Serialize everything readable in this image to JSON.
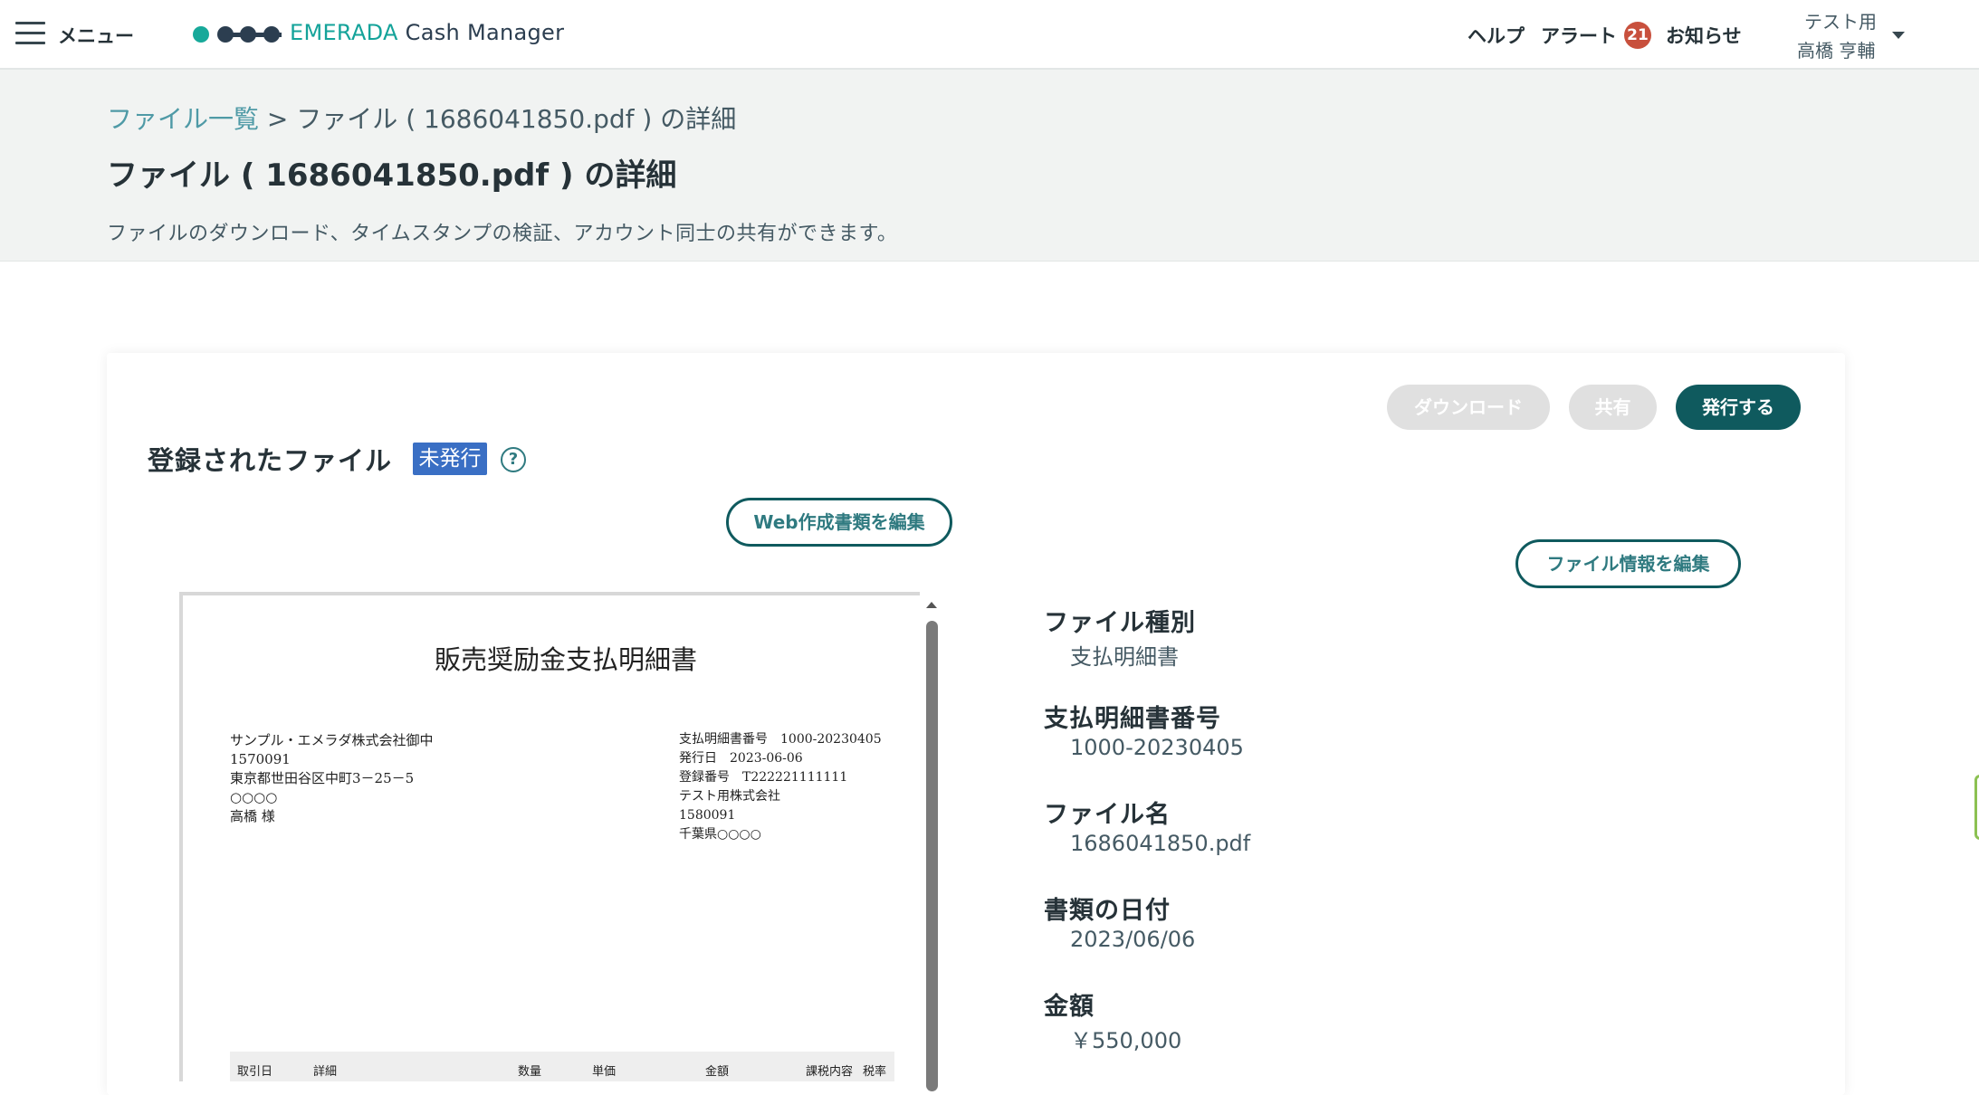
{
  "header": {
    "menu_label": "メニュー",
    "brand_part1": "EMERADA",
    "brand_part2": "Cash Manager",
    "help_label": "ヘルプ",
    "alert_label": "アラート",
    "alert_count": "21",
    "notice_label": "お知らせ",
    "user_org": "テスト用",
    "user_name": "高橋 亨輔"
  },
  "breadcrumb": {
    "link_label": "ファイル一覧",
    "separator": ">",
    "current": "ファイル ( 1686041850.pdf ) の詳細"
  },
  "page": {
    "title": "ファイル ( 1686041850.pdf ) の詳細",
    "description": "ファイルのダウンロード、タイムスタンプの検証、アカウント同士の共有ができます。"
  },
  "actions": {
    "download_label": "ダウンロード",
    "share_label": "共有",
    "issue_label": "発行する",
    "edit_web_doc_label": "Web作成書類を編集",
    "edit_file_info_label": "ファイル情報を編集"
  },
  "registered": {
    "section_title": "登録されたファイル",
    "status": "未発行",
    "help_symbol": "?"
  },
  "document": {
    "title": "販売奨励金支払明細書",
    "recipient_lines": [
      "サンプル・エメラダ株式会社御中",
      "1570091",
      "東京都世田谷区中町3－25－5",
      "○○○○",
      "高橋 様"
    ],
    "issuer_lines": [
      "支払明細書番号　1000-20230405",
      "発行日　2023-06-06",
      "登録番号　T222221111111",
      "テスト用株式会社",
      "1580091",
      "千葉県○○○○"
    ],
    "table_headers": [
      "取引日",
      "詳細",
      "数量",
      "単価",
      "金額",
      "課税内容",
      "税率"
    ]
  },
  "file_info": [
    {
      "label": "ファイル種別",
      "value": "支払明細書"
    },
    {
      "label": "支払明細書番号",
      "value": "1000-20230405"
    },
    {
      "label": "ファイル名",
      "value": "1686041850.pdf"
    },
    {
      "label": "書類の日付",
      "value": "2023/06/06"
    },
    {
      "label": "金額",
      "value": "￥550,000"
    }
  ],
  "colors": {
    "primary": "#0f5a5e",
    "accent": "#14a39a",
    "link": "#4f9aa6",
    "badge": "#c8503d",
    "status_tag": "#3a6fc4",
    "disabled": "#e0e0e0"
  }
}
